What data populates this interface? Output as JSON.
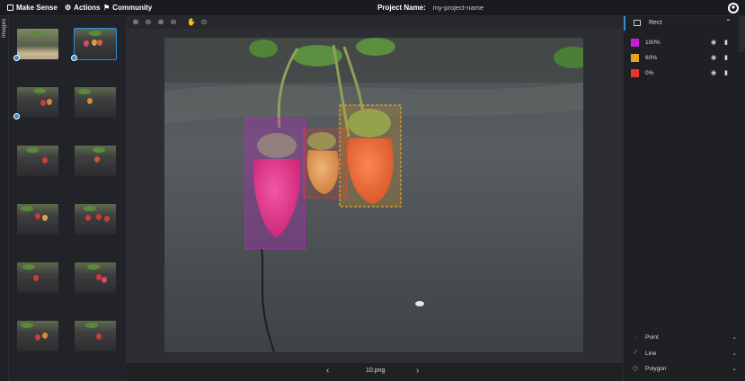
{
  "topbar": {
    "menu": [
      {
        "label": "Make Sense",
        "icon": "logo-icon"
      },
      {
        "label": "Actions",
        "icon": "actions-icon"
      },
      {
        "label": "Community",
        "icon": "community-icon"
      }
    ],
    "project_label": "Project Name:",
    "project_name": "my-project-name"
  },
  "side_tab": {
    "label": "Images"
  },
  "thumbnails": [
    {
      "checked": true,
      "active": false
    },
    {
      "checked": true,
      "active": true
    },
    {
      "checked": true,
      "active": false
    },
    {
      "checked": false,
      "active": false
    },
    {
      "checked": false,
      "active": false
    },
    {
      "checked": false,
      "active": false
    },
    {
      "checked": false,
      "active": false
    },
    {
      "checked": false,
      "active": false
    },
    {
      "checked": false,
      "active": false
    },
    {
      "checked": false,
      "active": false
    },
    {
      "checked": false,
      "active": false
    },
    {
      "checked": false,
      "active": false
    }
  ],
  "toolbar": [
    "zoom-in-icon",
    "zoom-out-icon",
    "zoom-fit-icon",
    "zoom-reset-icon",
    "hand-icon",
    "crosshair-icon"
  ],
  "bottom": {
    "filename": "10.png",
    "prev": "‹",
    "next": "›"
  },
  "right_panel": {
    "rect_label": "Rect",
    "labels": [
      {
        "name": "100%",
        "color": "#c61fd6"
      },
      {
        "name": "60%",
        "color": "#e8a321"
      },
      {
        "name": "0%",
        "color": "#e8362f"
      }
    ],
    "tools": [
      {
        "name": "Point"
      },
      {
        "name": "Line"
      },
      {
        "name": "Polygon"
      }
    ]
  },
  "colors": {
    "accent": "#2f8fd8",
    "bbox_purple": "#c61fd6",
    "bbox_orange": "#e8a321",
    "bbox_red": "#e8362f"
  }
}
